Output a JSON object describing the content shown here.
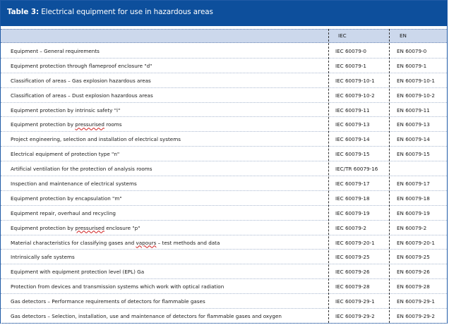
{
  "title": {
    "bold": "Table 3:",
    "text": " Electrical equipment for use in hazardous areas"
  },
  "columns": {
    "iec": "IEC",
    "en": "EN"
  },
  "rows": [
    {
      "a": "Equipment – General requirements",
      "iec": "IEC 60079-0",
      "en": "EN 60079-0"
    },
    {
      "a": "Equipment protection through flameproof enclosure   \"d\"",
      "iec": "IEC 60079-1",
      "en": "EN 60079-1"
    },
    {
      "a": "Classification of areas – Gas explosion hazardous areas",
      "iec": "IEC 60079-10-1",
      "en": "EN 60079-10-1"
    },
    {
      "a": "Classification of areas – Dust explosion hazardous areas",
      "iec": "IEC 60079-10-2",
      "en": "EN 60079-10-2"
    },
    {
      "a": "Equipment protection by intrinsic safety \"i\"",
      "iec": "IEC 60079-11",
      "en": "EN 60079-11"
    },
    {
      "pre": "Equipment protection by ",
      "sq": "pressurised",
      "post": " rooms",
      "iec": "IEC 60079-13",
      "en": "EN 60079-13"
    },
    {
      "a": "Project engineering, selection and installation of electrical systems",
      "iec": "IEC 60079-14",
      "en": "EN 60079-14"
    },
    {
      "a": "Electrical equipment of protection type \"n\"",
      "iec": "IEC 60079-15",
      "en": "EN 60079-15"
    },
    {
      "a": "Artificial ventilation for the protection of analysis rooms",
      "iec": "IEC/TR 60079-16",
      "en": ""
    },
    {
      "a": "Inspection and maintenance of electrical systems",
      "iec": "IEC 60079-17",
      "en": "EN 60079-17"
    },
    {
      "a": "Equipment protection by encapsulation \"m\"",
      "iec": "IEC 60079-18",
      "en": "EN 60079-18"
    },
    {
      "a": "Equipment repair, overhaul and  recycling",
      "iec": "IEC 60079-19",
      "en": "EN 60079-19"
    },
    {
      "pre": "Equipment protection by ",
      "sq": "pressurised",
      "post": " enclosure \"p\"",
      "iec": "IEC 60079-2",
      "en": "EN 60079-2"
    },
    {
      "pre": "Material characteristics for classifying gases and ",
      "sq": "vapours",
      "post": " – test methods and data",
      "iec": "IEC 60079-20-1",
      "en": "EN 60079-20-1"
    },
    {
      "a": "Intrinsically safe systems",
      "iec": "IEC 60079-25",
      "en": "EN 60079-25"
    },
    {
      "a": "Equipment with equipment protection level (EPL)  Ga",
      "iec": "IEC 60079-26",
      "en": "EN 60079-26"
    },
    {
      "a": "Protection from devices and transmission systems which work with optical radiation",
      "iec": "IEC 60079-28",
      "en": "EN 60079-28"
    },
    {
      "a": "Gas detectors – Performance requirements of detectors for flammable gases",
      "iec": "IEC 60079-29-1",
      "en": "EN 60079-29-1"
    },
    {
      "a": "Gas detectors – Selection, installation, use and maintenance of detectors for flammable gases and oxygen",
      "iec": "IEC 60079-29-2",
      "en": "EN 60079-29-2"
    }
  ]
}
